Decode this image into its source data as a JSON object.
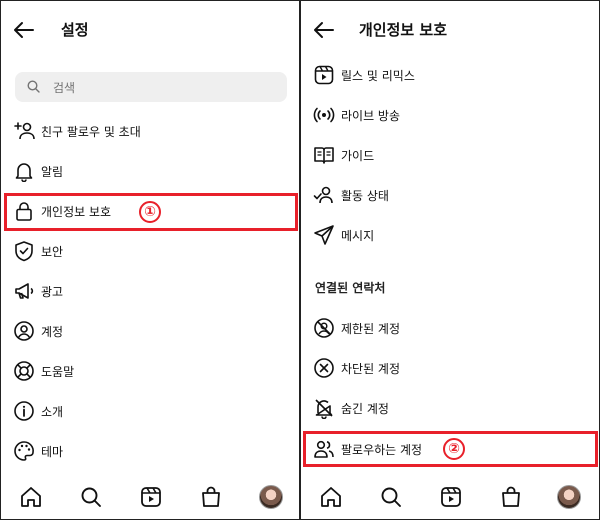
{
  "left": {
    "title": "설정",
    "search_placeholder": "검색",
    "items": [
      {
        "label": "친구 팔로우 및 초대",
        "icon": "add-person-icon"
      },
      {
        "label": "알림",
        "icon": "bell-icon"
      },
      {
        "label": "개인정보 보호",
        "icon": "lock-icon"
      },
      {
        "label": "보안",
        "icon": "shield-check-icon"
      },
      {
        "label": "광고",
        "icon": "megaphone-icon"
      },
      {
        "label": "계정",
        "icon": "account-circle-icon"
      },
      {
        "label": "도움말",
        "icon": "lifebuoy-icon"
      },
      {
        "label": "소개",
        "icon": "info-icon"
      },
      {
        "label": "테마",
        "icon": "palette-icon"
      }
    ],
    "callout": "①"
  },
  "right": {
    "title": "개인정보 보호",
    "items": [
      {
        "label": "릴스 및 리믹스",
        "icon": "reels-icon"
      },
      {
        "label": "라이브 방송",
        "icon": "live-broadcast-icon"
      },
      {
        "label": "가이드",
        "icon": "guide-book-icon"
      },
      {
        "label": "활동 상태",
        "icon": "activity-status-icon"
      },
      {
        "label": "메시지",
        "icon": "send-icon"
      }
    ],
    "section_heading": "연결된 연락처",
    "connected_items": [
      {
        "label": "제한된 계정",
        "icon": "restricted-icon"
      },
      {
        "label": "차단된 계정",
        "icon": "blocked-icon"
      },
      {
        "label": "숨긴 계정",
        "icon": "muted-bell-icon"
      },
      {
        "label": "팔로우하는 계정",
        "icon": "people-icon"
      }
    ],
    "callout": "②"
  },
  "bottom_nav": [
    "home-icon",
    "search-icon",
    "reels-icon",
    "shop-icon",
    "profile-avatar"
  ],
  "colors": {
    "highlight": "#e8202a",
    "search_bg": "#efefef"
  }
}
